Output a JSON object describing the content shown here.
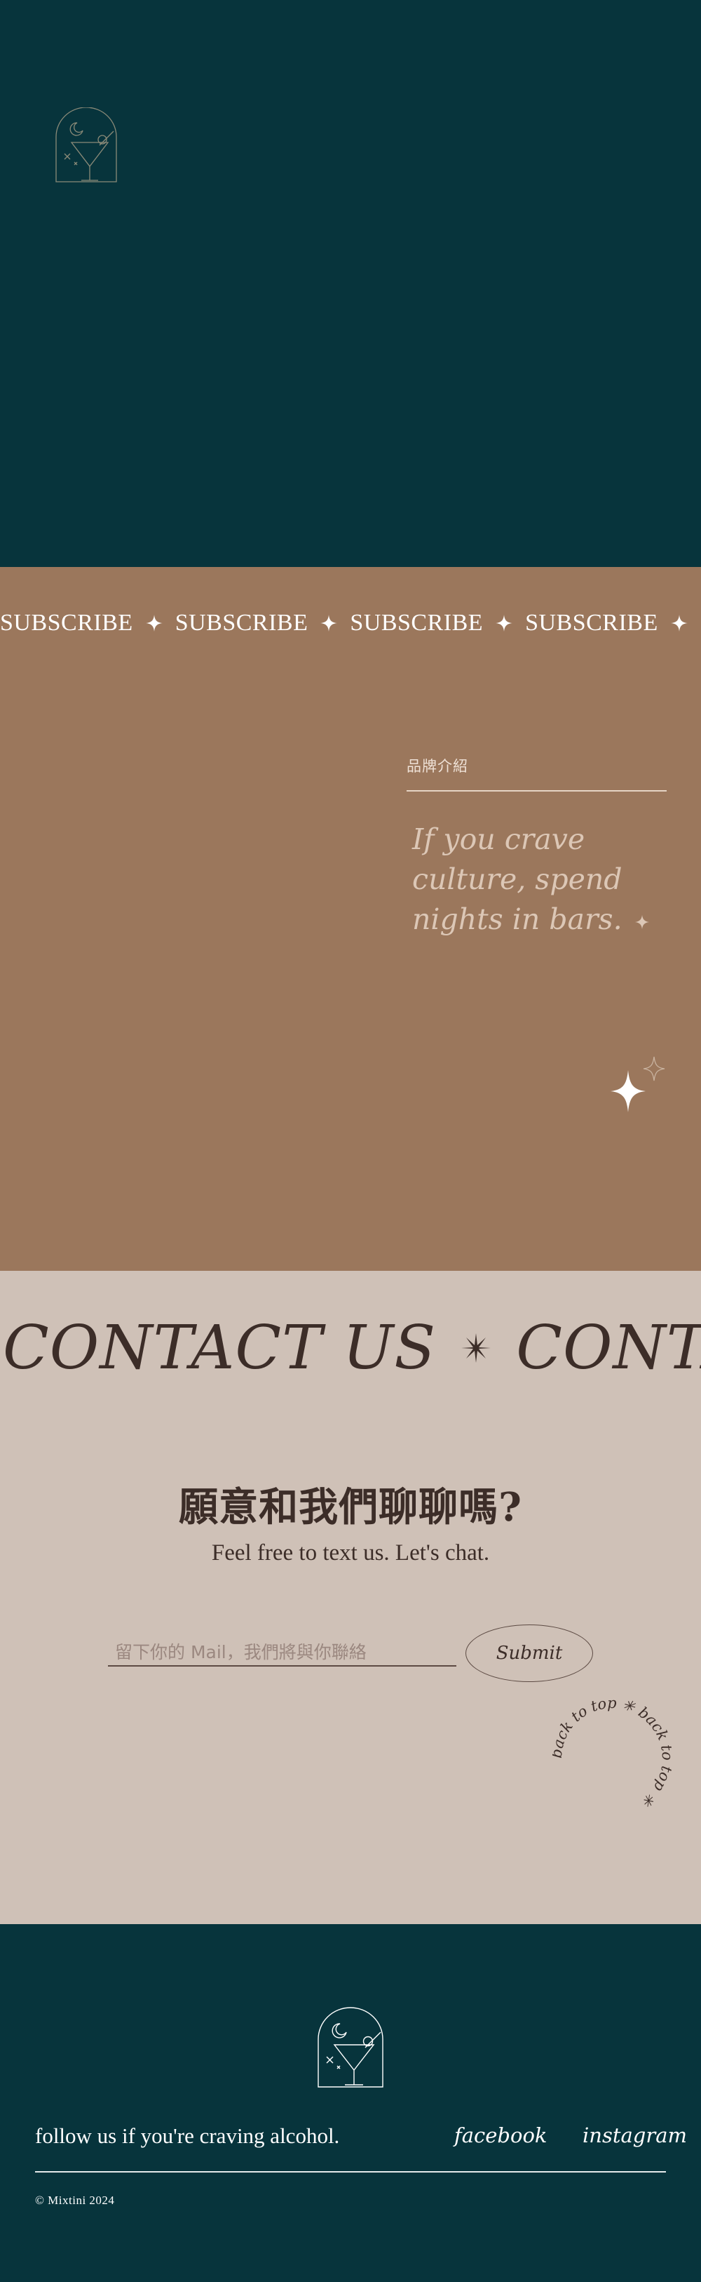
{
  "marquee": {
    "word": "SUBSCRIBE",
    "repeat": 5,
    "text_color": "#ffffff",
    "background": "#9b775c"
  },
  "brand": {
    "label": "品牌介紹",
    "quote": "If you crave culture, spend nights in bars."
  },
  "contact": {
    "marquee_word": "CONTACT US",
    "repeat": 3,
    "title": "願意和我們聊聊嗎?",
    "subtitle": "Feel free to text us. Let's chat.",
    "email_placeholder": "留下你的 Mail，我們將與你聯絡",
    "submit_label": "Submit",
    "back_to_top": "back to top"
  },
  "footer": {
    "follow_text": "follow us if you're craving alcohol.",
    "facebook_label": "facebook",
    "instagram_label": "instagram",
    "copyright": "© Mixtini 2024"
  },
  "icons": {
    "logo": "cocktail-arch-logo-icon",
    "marquee_star": "four-point-star-icon",
    "contact_star": "asterisk-star-icon",
    "sparkle": "sparkle-icon"
  },
  "colors": {
    "dark_teal": "#07343c",
    "tan": "#9b775c",
    "beige": "#cfc1b7",
    "dark_brown": "#3c2d28",
    "white": "#ffffff"
  }
}
